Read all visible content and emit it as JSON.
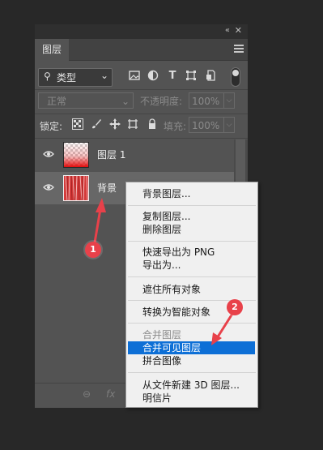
{
  "panel": {
    "collapse_glyph": "«",
    "close_glyph": "✕",
    "tab_label": "图层"
  },
  "filter": {
    "kind_label": "类型",
    "icons": [
      "image-filter-icon",
      "adjustment-filter-icon",
      "type-filter-icon",
      "shape-filter-icon",
      "smart-object-filter-icon"
    ]
  },
  "blend": {
    "mode_label": "正常",
    "opacity_label": "不透明度:",
    "opacity_value": "100%",
    "lock_label": "锁定:",
    "fill_label": "填充:",
    "fill_value": "100%"
  },
  "layers": [
    {
      "name": "图层 1",
      "visible": true,
      "selected": false
    },
    {
      "name": "背景",
      "visible": true,
      "selected": true
    }
  ],
  "bottom": {
    "link_icon": "⊖",
    "fx_label": "fx"
  },
  "context_menu": {
    "groups": [
      [
        {
          "label": "背景图层...",
          "enabled": true
        }
      ],
      [
        {
          "label": "复制图层...",
          "enabled": true
        },
        {
          "label": "删除图层",
          "enabled": true
        }
      ],
      [
        {
          "label": "快速导出为 PNG",
          "enabled": true
        },
        {
          "label": "导出为...",
          "enabled": true
        }
      ],
      [
        {
          "label": "遮住所有对象",
          "enabled": true
        }
      ],
      [
        {
          "label": "转换为智能对象",
          "enabled": true
        }
      ],
      [
        {
          "label": "合并图层",
          "enabled": false
        },
        {
          "label": "合并可见图层",
          "enabled": true,
          "highlighted": true
        },
        {
          "label": "拼合图像",
          "enabled": true
        }
      ],
      [
        {
          "label": "从文件新建 3D 图层...",
          "enabled": true
        },
        {
          "label": "明信片",
          "enabled": true
        }
      ]
    ]
  },
  "annotations": [
    {
      "number": "1"
    },
    {
      "number": "2"
    }
  ],
  "colors": {
    "highlight": "#0d6fd6",
    "annotation": "#e8414a",
    "panel_bg": "#535353"
  }
}
